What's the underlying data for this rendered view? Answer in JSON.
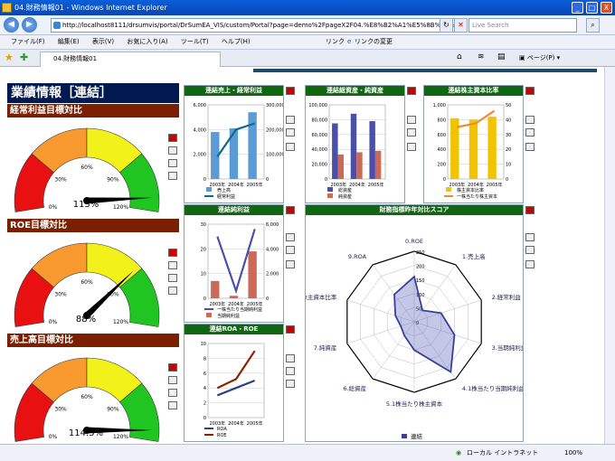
{
  "window": {
    "title": "04.財務情報01 - Windows Internet Explorer",
    "min": "_",
    "max": "□",
    "close": "X"
  },
  "address": {
    "url": "http://localhost8111/drsumvis/portal/DrSumEA_VIS/custom/Portal?page=demo%2FpageX2F04.%E8%B2%A1%E5%8B%99%",
    "search_placeholder": "Live Search",
    "back": "◀",
    "forward": "▶"
  },
  "menu": {
    "items": [
      "ファイル(F)",
      "編集(E)",
      "表示(V)",
      "お気に入り(A)",
      "ツール(T)",
      "ヘルプ(H)"
    ],
    "links_label": "リンク",
    "links_change": "リンクの変更"
  },
  "tab": {
    "label": "04.財務情報01",
    "page_menu": "ページ(P)"
  },
  "page": {
    "title": "業績情報［連結］"
  },
  "gauges": [
    {
      "title": "経常利益目標対比",
      "value_label": "113%",
      "value": 113,
      "ticks": [
        "0%",
        "30%",
        "60%",
        "90%",
        "120%"
      ]
    },
    {
      "title": "ROE目標対比",
      "value_label": "88%",
      "value": 88,
      "ticks": [
        "0%",
        "30%",
        "60%",
        "90%",
        "120%"
      ]
    },
    {
      "title": "売上高目標対比",
      "value_label": "114.5%",
      "value": 114.5,
      "ticks": [
        "0%",
        "30%",
        "60%",
        "90%",
        "120%"
      ]
    }
  ],
  "chart_data": [
    {
      "type": "bar",
      "title": "連結売上・経常利益",
      "categories": [
        "2003年",
        "2004年",
        "2005年"
      ],
      "series": [
        {
          "name": "売上高",
          "kind": "bar",
          "axis": "right",
          "values": [
            190000,
            205000,
            270000
          ],
          "color": "#5b9bd5"
        },
        {
          "name": "経常利益",
          "kind": "line",
          "axis": "left",
          "values": [
            1800,
            4000,
            4500
          ],
          "color": "#0d6a8c"
        }
      ],
      "ylim": [
        0,
        6000
      ],
      "y2lim": [
        0,
        300000
      ],
      "yticks": [
        "0",
        "2,000",
        "4,000",
        "6,000"
      ],
      "y2ticks": [
        "0",
        "100,000",
        "200,000",
        "300,000"
      ]
    },
    {
      "type": "bar",
      "title": "連結総資産・純資産",
      "categories": [
        "2003年",
        "2004年",
        "2005年"
      ],
      "series": [
        {
          "name": "総資産",
          "values": [
            75000,
            88000,
            78000
          ],
          "color": "#4a4faa"
        },
        {
          "name": "純資産",
          "values": [
            33000,
            36000,
            38000
          ],
          "color": "#cc6a5a"
        }
      ],
      "ylim": [
        0,
        100000
      ],
      "yticks": [
        "0",
        "20,000",
        "40,000",
        "60,000",
        "80,000",
        "100,000"
      ]
    },
    {
      "type": "bar",
      "title": "連結株主資本比率",
      "categories": [
        "2003年",
        "2004年",
        "2005年"
      ],
      "series": [
        {
          "name": "株主資本比率",
          "kind": "bar",
          "axis": "right",
          "values": [
            41,
            40,
            42
          ],
          "color": "#f2c300"
        },
        {
          "name": "一株当たり株主資本",
          "kind": "line",
          "axis": "left",
          "values": [
            700,
            750,
            920
          ],
          "color": "#f08a30"
        }
      ],
      "ylim": [
        0,
        1000
      ],
      "y2lim": [
        0,
        50
      ],
      "yticks": [
        "0",
        "200",
        "400",
        "600",
        "800",
        "1,000"
      ],
      "y2ticks": [
        "0",
        "10",
        "20",
        "30",
        "40",
        "50"
      ]
    },
    {
      "type": "bar",
      "title": "連結純利益",
      "categories": [
        "2003年",
        "2004年",
        "2005年"
      ],
      "series": [
        {
          "name": "一株当たり当期純利益",
          "kind": "line",
          "axis": "left",
          "values": [
            25,
            3,
            28
          ],
          "color": "#4a4faa"
        },
        {
          "name": "当期純利益",
          "kind": "bar",
          "axis": "right",
          "values": [
            1400,
            200,
            3800
          ],
          "color": "#cc6a5a"
        }
      ],
      "ylim": [
        0,
        30
      ],
      "y2lim": [
        0,
        6000
      ],
      "yticks": [
        "0",
        "10",
        "20",
        "30"
      ],
      "y2ticks": [
        "0",
        "2,000",
        "4,000",
        "6,000"
      ]
    },
    {
      "type": "line",
      "title": "連結ROA・ROE",
      "categories": [
        "2003年",
        "2004年",
        "2005年"
      ],
      "series": [
        {
          "name": "ROA",
          "values": [
            3,
            4,
            5
          ],
          "color": "#2c3f80"
        },
        {
          "name": "ROE",
          "values": [
            4,
            5.2,
            9
          ],
          "color": "#8a2200"
        }
      ],
      "ylim": [
        0,
        10
      ],
      "yticks": [
        "0",
        "2",
        "4",
        "6",
        "8",
        "10"
      ]
    },
    {
      "type": "radar",
      "title": "財務指標昨年対比スコア",
      "axes": [
        "0.ROE",
        "1.売上高",
        "2.経常利益",
        "3.当期純利益",
        "4.1株当たり当期純利益",
        "5.1株当たり株主資本",
        "6.総資産",
        "7.純資産",
        "8.株主資本比率",
        "9.ROA"
      ],
      "series": [
        {
          "name": "連結",
          "values": [
            160,
            50,
            100,
            150,
            220,
            100,
            60,
            50,
            70,
            120
          ],
          "color": "#3a3f9a"
        }
      ],
      "ticks": [
        "0",
        "50",
        "100",
        "150",
        "200",
        "250"
      ],
      "rlim": [
        0,
        250
      ]
    }
  ],
  "status": {
    "zone": "ローカル イントラネット",
    "zoom": "100%"
  }
}
